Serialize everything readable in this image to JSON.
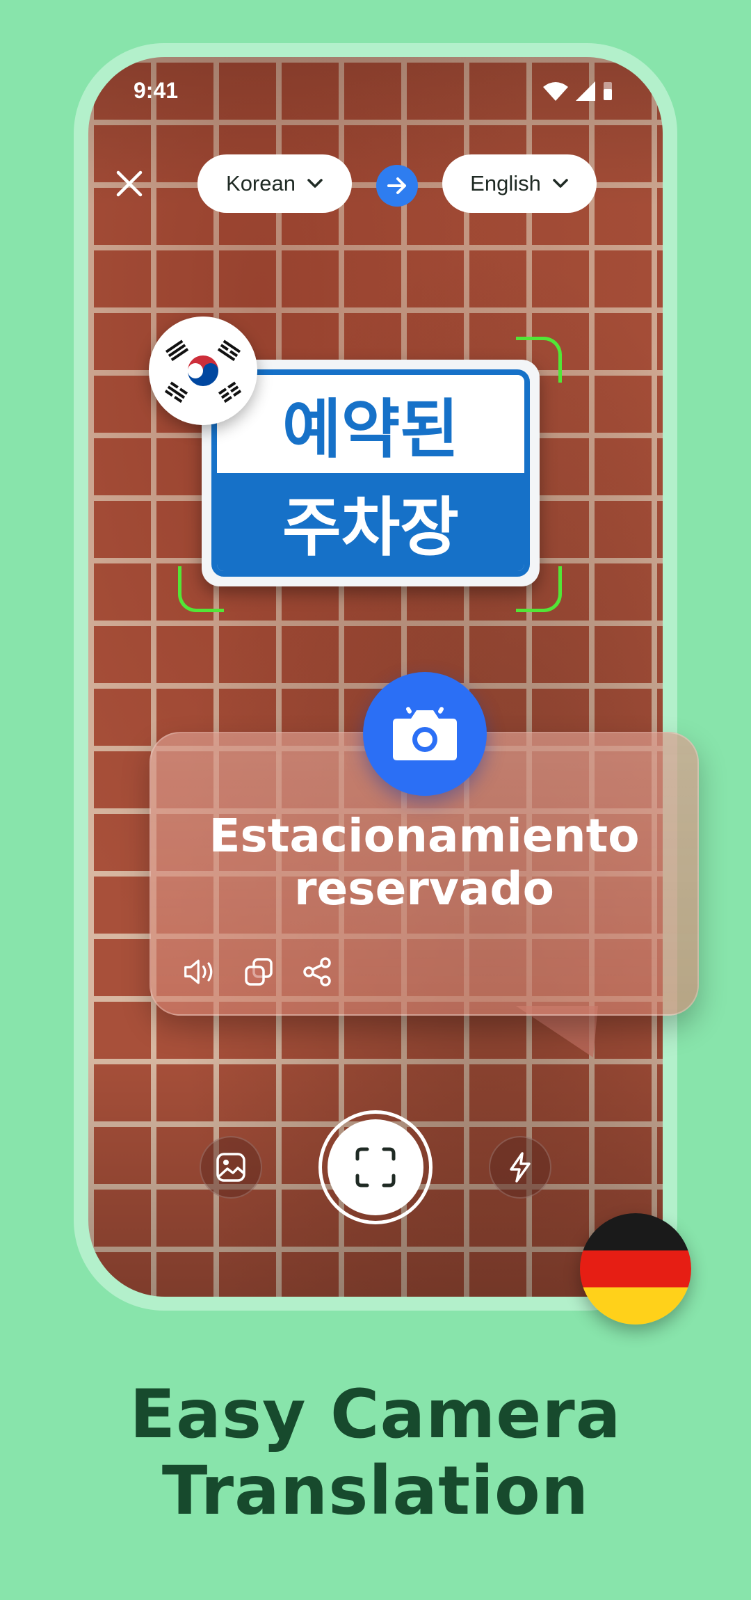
{
  "status_bar": {
    "time": "9:41",
    "icons": [
      "wifi-icon",
      "signal-icon",
      "battery-icon"
    ]
  },
  "toolbar": {
    "close_icon": "close-icon",
    "source_language": "Korean",
    "target_language": "English",
    "swap_icon": "arrow-right-icon"
  },
  "sign": {
    "line1": "예약된",
    "line2": "주차장"
  },
  "source_flag": "south-korea-flag",
  "target_flag": "germany-flag",
  "result": {
    "translation": "Estacionamiento reservado",
    "actions": [
      "speaker-icon",
      "copy-icon",
      "share-icon"
    ]
  },
  "controls": {
    "gallery_icon": "image-icon",
    "shutter_icon": "scan-frame-icon",
    "flash_icon": "flash-icon",
    "camera_icon": "camera-icon"
  },
  "headline": "Easy Camera Translation",
  "colors": {
    "background": "#88e4ab",
    "accent_blue": "#2e7df0",
    "scan_green": "#52e637",
    "headline": "#174a2d"
  }
}
